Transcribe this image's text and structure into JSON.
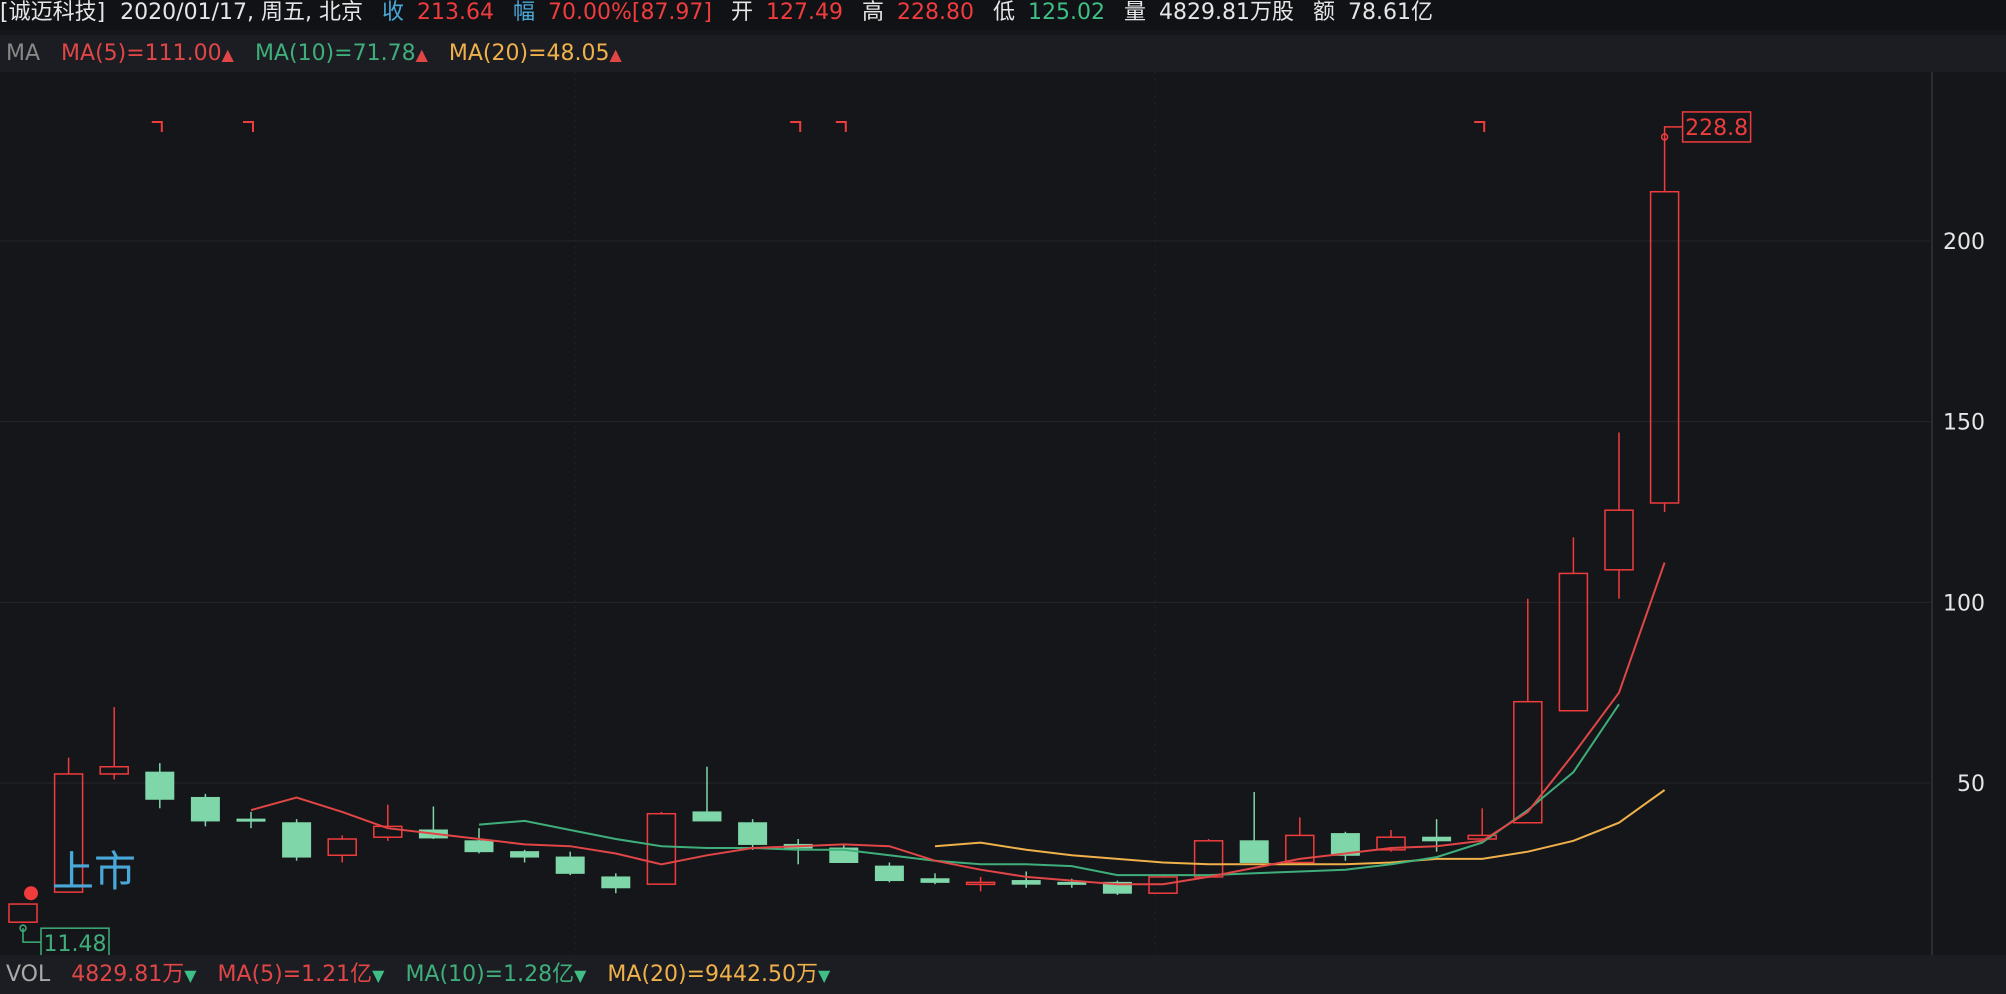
{
  "header": {
    "stock_name": "[诚迈科技]",
    "date_info": "2020/01/17, 周五, 北京",
    "close_label": "收",
    "close_value": "213.64",
    "range_label": "幅",
    "range_value": "70.00%",
    "range_extra": "[87.97]",
    "open_label": "开",
    "open_value": "127.49",
    "high_label": "高",
    "high_value": "228.80",
    "low_label": "低",
    "low_value": "125.02",
    "volume_label": "量",
    "volume_value": "4829.81万股",
    "amount_label": "额",
    "amount_value": "78.61亿"
  },
  "ma_legend": {
    "title": "MA",
    "ma5": "MA(5)=111.00",
    "ma10": "MA(10)=71.78",
    "ma20": "MA(20)=48.05"
  },
  "vol_legend": {
    "title": "VOL",
    "vol": "4829.81万",
    "ma5": "MA(5)=1.21亿",
    "ma10": "MA(10)=1.28亿",
    "ma20": "MA(20)=9442.50万"
  },
  "colors": {
    "up": "#f03c3c",
    "down": "#7fd6a8",
    "ma5": "#e04646",
    "ma10": "#3fae7a",
    "ma20": "#f0b04a",
    "background": "#14161a"
  },
  "annotations": {
    "listing_label": "上市",
    "high_marker": "228.8",
    "low_marker": "11.48"
  },
  "chart_data": {
    "type": "candlestick",
    "y_ticks": [
      "50",
      "100",
      "150",
      "200"
    ],
    "ylim": [
      10,
      240
    ],
    "candles": [
      {
        "o": 11.48,
        "h": 16.5,
        "l": 11.48,
        "c": 16.5
      },
      {
        "o": 19.8,
        "h": 57.0,
        "l": 19.8,
        "c": 52.5
      },
      {
        "o": 52.5,
        "h": 71.0,
        "l": 51.0,
        "c": 54.5
      },
      {
        "o": 53.0,
        "h": 55.5,
        "l": 43.0,
        "c": 45.5
      },
      {
        "o": 46.0,
        "h": 47.0,
        "l": 38.0,
        "c": 39.5
      },
      {
        "o": 40.0,
        "h": 42.0,
        "l": 37.5,
        "c": 39.5
      },
      {
        "o": 39.0,
        "h": 40.0,
        "l": 28.5,
        "c": 29.5
      },
      {
        "o": 30.0,
        "h": 35.5,
        "l": 28.0,
        "c": 34.5
      },
      {
        "o": 35.0,
        "h": 44.0,
        "l": 34.0,
        "c": 38.0
      },
      {
        "o": 37.0,
        "h": 43.5,
        "l": 34.5,
        "c": 34.8
      },
      {
        "o": 34.0,
        "h": 37.5,
        "l": 30.5,
        "c": 31.0
      },
      {
        "o": 31.0,
        "h": 31.5,
        "l": 28.0,
        "c": 29.5
      },
      {
        "o": 29.5,
        "h": 31.0,
        "l": 24.5,
        "c": 25.0
      },
      {
        "o": 24.0,
        "h": 25.0,
        "l": 19.5,
        "c": 21.0
      },
      {
        "o": 22.0,
        "h": 42.0,
        "l": 22.0,
        "c": 41.5
      },
      {
        "o": 42.0,
        "h": 54.5,
        "l": 39.5,
        "c": 39.5
      },
      {
        "o": 39.0,
        "h": 40.0,
        "l": 31.5,
        "c": 33.0
      },
      {
        "o": 33.0,
        "h": 34.5,
        "l": 27.5,
        "c": 32.0
      },
      {
        "o": 32.0,
        "h": 33.0,
        "l": 28.0,
        "c": 28.0
      },
      {
        "o": 27.0,
        "h": 28.0,
        "l": 22.5,
        "c": 23.0
      },
      {
        "o": 23.5,
        "h": 25.0,
        "l": 22.0,
        "c": 22.5
      },
      {
        "o": 22.0,
        "h": 24.0,
        "l": 20.0,
        "c": 22.5
      },
      {
        "o": 23.0,
        "h": 25.5,
        "l": 21.0,
        "c": 22.0
      },
      {
        "o": 22.5,
        "h": 23.5,
        "l": 21.0,
        "c": 22.0
      },
      {
        "o": 22.5,
        "h": 23.0,
        "l": 19.0,
        "c": 19.5
      },
      {
        "o": 19.5,
        "h": 24.5,
        "l": 19.5,
        "c": 24.0
      },
      {
        "o": 24.0,
        "h": 34.5,
        "l": 24.0,
        "c": 34.0
      },
      {
        "o": 34.0,
        "h": 47.5,
        "l": 28.0,
        "c": 28.0
      },
      {
        "o": 28.0,
        "h": 40.5,
        "l": 27.5,
        "c": 35.5
      },
      {
        "o": 36.0,
        "h": 36.5,
        "l": 28.5,
        "c": 30.0
      },
      {
        "o": 31.5,
        "h": 37.0,
        "l": 31.0,
        "c": 35.0
      },
      {
        "o": 35.0,
        "h": 40.0,
        "l": 31.0,
        "c": 34.0
      },
      {
        "o": 34.5,
        "h": 43.0,
        "l": 34.0,
        "c": 35.5
      },
      {
        "o": 39.0,
        "h": 101.0,
        "l": 39.0,
        "c": 72.5
      },
      {
        "o": 70.0,
        "h": 118.0,
        "l": 70.0,
        "c": 108.0
      },
      {
        "o": 109.0,
        "h": 147.0,
        "l": 101.0,
        "c": 125.5
      },
      {
        "o": 127.49,
        "h": 228.8,
        "l": 125.02,
        "c": 213.64
      }
    ],
    "ma5": [
      null,
      null,
      null,
      null,
      null,
      42.5,
      46.0,
      42.0,
      37.5,
      36.0,
      34.5,
      33.0,
      32.5,
      30.5,
      27.5,
      30.0,
      32.0,
      32.5,
      33.0,
      32.5,
      28.5,
      26.0,
      24.0,
      23.0,
      22.0,
      22.0,
      24.0,
      26.5,
      29.0,
      30.5,
      32.0,
      32.5,
      34.0,
      42.0,
      58.0,
      75.0,
      111.0
    ],
    "ma10": [
      null,
      null,
      null,
      null,
      null,
      null,
      null,
      null,
      null,
      null,
      38.5,
      39.5,
      37.0,
      34.5,
      32.5,
      32.0,
      32.0,
      31.5,
      31.5,
      30.0,
      28.5,
      27.5,
      27.5,
      27.0,
      24.5,
      24.5,
      24.5,
      25.0,
      25.5,
      26.0,
      27.5,
      29.5,
      33.5,
      42.5,
      53.0,
      71.78
    ],
    "ma20": [
      null,
      null,
      null,
      null,
      null,
      null,
      null,
      null,
      null,
      null,
      null,
      null,
      null,
      null,
      null,
      null,
      null,
      null,
      null,
      null,
      32.5,
      33.5,
      31.5,
      30.0,
      29.0,
      28.0,
      27.5,
      27.5,
      27.5,
      27.5,
      28.0,
      29.0,
      29.0,
      31.0,
      34.0,
      39.0,
      48.05
    ],
    "period_markers": [
      3,
      5,
      17,
      18,
      32
    ]
  }
}
